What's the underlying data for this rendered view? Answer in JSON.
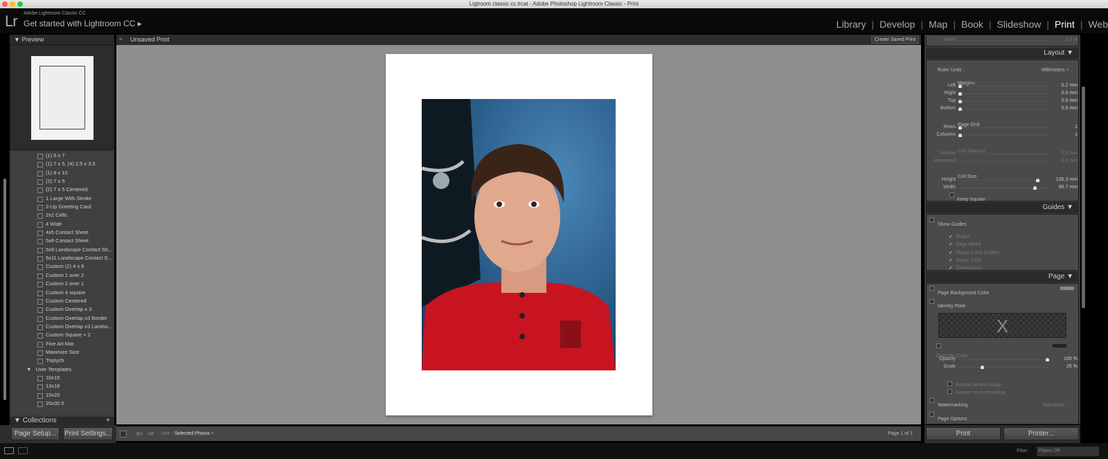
{
  "window": {
    "title": "Ligtroom classic cc.lrcat - Adobe Photoshop Lightroom Classic - Print"
  },
  "identity": {
    "logo": "Lr",
    "app_name": "Adobe Lightroom Classic CC",
    "get_started": "Get started with Lightroom CC ▸"
  },
  "modules": [
    {
      "label": "Library"
    },
    {
      "label": "Develop"
    },
    {
      "label": "Map"
    },
    {
      "label": "Book"
    },
    {
      "label": "Slideshow"
    },
    {
      "label": "Print",
      "active": true
    },
    {
      "label": "Web"
    }
  ],
  "left": {
    "preview_label": "Preview",
    "templates": [
      "(1) 5 x 7",
      "(1) 7 x 5, (4) 2.5 x 3.5",
      "(1) 8 x 10",
      "(2) 7 x 5",
      "(2) 7 x 5 Centered",
      "1 Large With Stroke",
      "2-Up Greeting Card",
      "2x2 Cells",
      "4 Wide",
      "4x5 Contact Sheet",
      "5x8 Contact Sheet",
      "5x9 Landscape Contact Sh...",
      "5x11 Landscape Contact S...",
      "Custom (2) 4 x 6",
      "Custom 1 over 2",
      "Custom 2 over 1",
      "Custom 4 square",
      "Custom Centered",
      "Custom Overlap x 3",
      "Custom Overlap x3 Border",
      "Custom Overlap x3 Landsc...",
      "Custom Square + 2",
      "Fine Art Mat",
      "Maximize Size",
      "Triptych"
    ],
    "user_templates_label": "User Templates",
    "user_templates": [
      "10x15",
      "13x18",
      "15x20",
      "20x30.5"
    ],
    "collections_label": "Collections",
    "collections_add": "+",
    "page_setup": "Page Setup...",
    "print_settings": "Print Settings..."
  },
  "center": {
    "title": "Unsaved Print",
    "create_saved_print": "Create Saved Print",
    "use_label": "Use :",
    "use_value": "Selected Photos ÷",
    "page_count": "Page 1 of 1"
  },
  "right": {
    "width_label": "Width",
    "width_value": "1.0 pt",
    "layout": {
      "title": "Layout ▼",
      "ruler_units_label": "Ruler Units :",
      "ruler_units_value": "Millimeters ÷",
      "margins_title": "Margins",
      "margins": [
        {
          "label": "Left",
          "value": "0.2 mm"
        },
        {
          "label": "Right",
          "value": "0.0 mm"
        },
        {
          "label": "Top",
          "value": "0.0 mm"
        },
        {
          "label": "Bottom",
          "value": "0.0 mm"
        }
      ],
      "grid_title": "Page Grid",
      "grid": [
        {
          "label": "Rows",
          "value": "1"
        },
        {
          "label": "Columns",
          "value": "1"
        }
      ],
      "spacing_title": "Cell Spacing",
      "spacing": [
        {
          "label": "Vertical",
          "value": "0.0 mm"
        },
        {
          "label": "Horizontal",
          "value": "0.0 mm"
        }
      ],
      "size_title": "Cell Size",
      "size": [
        {
          "label": "Height",
          "value": "135.3 mm",
          "level": 0.87
        },
        {
          "label": "Width",
          "value": "96.7 mm",
          "level": 0.84
        }
      ],
      "keep_square": "Keep Square"
    },
    "guides": {
      "title": "Guides ▼",
      "show_guides": "Show Guides",
      "items": [
        "Rulers",
        "Page Bleed",
        "Margins and Gutters",
        "Image Cells",
        "Dimensions"
      ]
    },
    "page": {
      "title": "Page ▼",
      "bg_color": "Page Background Color",
      "identity_plate": "Identity Plate",
      "plate_text": "X",
      "override_color": "Override Color",
      "opacity_label": "Opacity",
      "opacity_value": "100 %",
      "scale_label": "Scale",
      "scale_value": "25 %",
      "render_behind": "Render behind image",
      "render_every": "Render on every image",
      "watermarking": "Watermarking :",
      "watermark_value": "Attendees ÷",
      "page_options": "Page Options"
    },
    "print_button": "Print",
    "printer_button": "Printer..."
  },
  "filmstrip": {
    "filter_label": "Filter :",
    "filter_value": "Filters Off"
  }
}
